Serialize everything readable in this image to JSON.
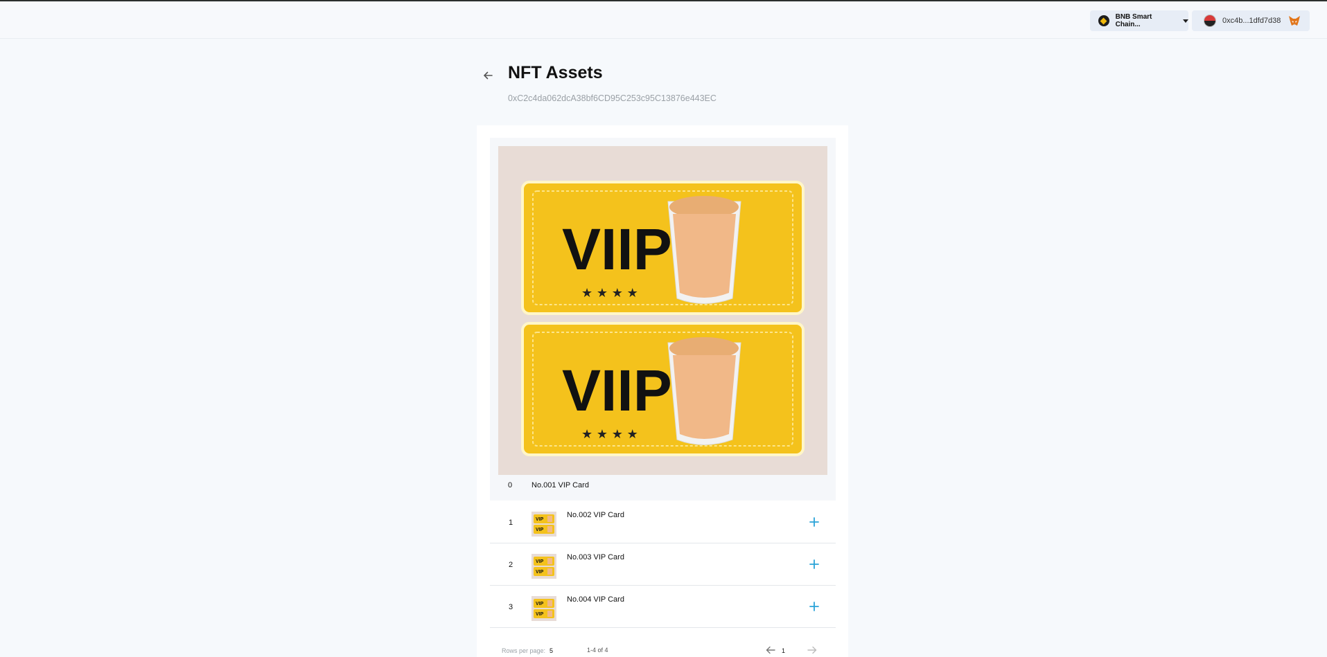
{
  "header": {
    "network_label": "BNB Smart Chain...",
    "wallet_address": "0xc4b...1dfd7d38",
    "icons": [
      "bnb-icon",
      "chevron-down-icon",
      "avatar",
      "metamask-fox-icon"
    ]
  },
  "page": {
    "title": "NFT Assets",
    "contract_address": "0xC2c4da062dcA38bf6CD95C253c95C13876e443EC",
    "back_icon": "arrow-left-icon"
  },
  "selected": {
    "index": "0",
    "name": "No.001 VIP Card",
    "ticket_text": "VIIP"
  },
  "rows": [
    {
      "index": "1",
      "name": "No.002 VIP Card"
    },
    {
      "index": "2",
      "name": "No.003 VIP Card"
    },
    {
      "index": "3",
      "name": "No.004 VIP Card"
    }
  ],
  "pagination": {
    "rows_per_page_label": "Rows per page:",
    "rows_per_page": "5",
    "range": "1-4 of 4",
    "page": "1"
  },
  "colors": {
    "accent": "#2aa3d8",
    "ticket_gold": "#f4c21c",
    "image_bg": "#e8dcd6"
  }
}
